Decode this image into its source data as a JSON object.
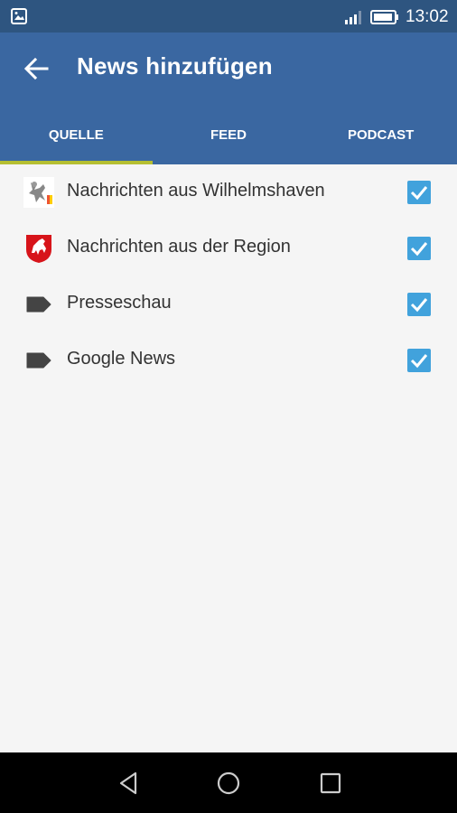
{
  "status_bar": {
    "time": "13:02",
    "left_icon": "gallery-icon",
    "signal_icon": "signal-icon",
    "battery_icon": "battery-icon"
  },
  "toolbar": {
    "title": "News hinzufügen",
    "back_icon": "back-arrow-icon"
  },
  "tabs": [
    {
      "label": "QUELLE",
      "selected": true
    },
    {
      "label": "FEED",
      "selected": false
    },
    {
      "label": "PODCAST",
      "selected": false
    }
  ],
  "sources": [
    {
      "label": "Nachrichten aus Wilhelmshaven",
      "icon": "wilhelmshaven-crest-icon",
      "checked": true
    },
    {
      "label": "Nachrichten aus der Region",
      "icon": "niedersachsen-crest-icon",
      "checked": true
    },
    {
      "label": "Presseschau",
      "icon": "tag-icon",
      "checked": true
    },
    {
      "label": "Google News",
      "icon": "tag-icon",
      "checked": true
    }
  ],
  "nav_bar": {
    "back": "nav-back-icon",
    "home": "nav-home-icon",
    "recents": "nav-recents-icon"
  },
  "colors": {
    "status_bar": "#2e5580",
    "toolbar": "#3a67a1",
    "tab_indicator": "#b5bf32",
    "checkbox": "#41a2dc",
    "background": "#f5f5f5"
  }
}
